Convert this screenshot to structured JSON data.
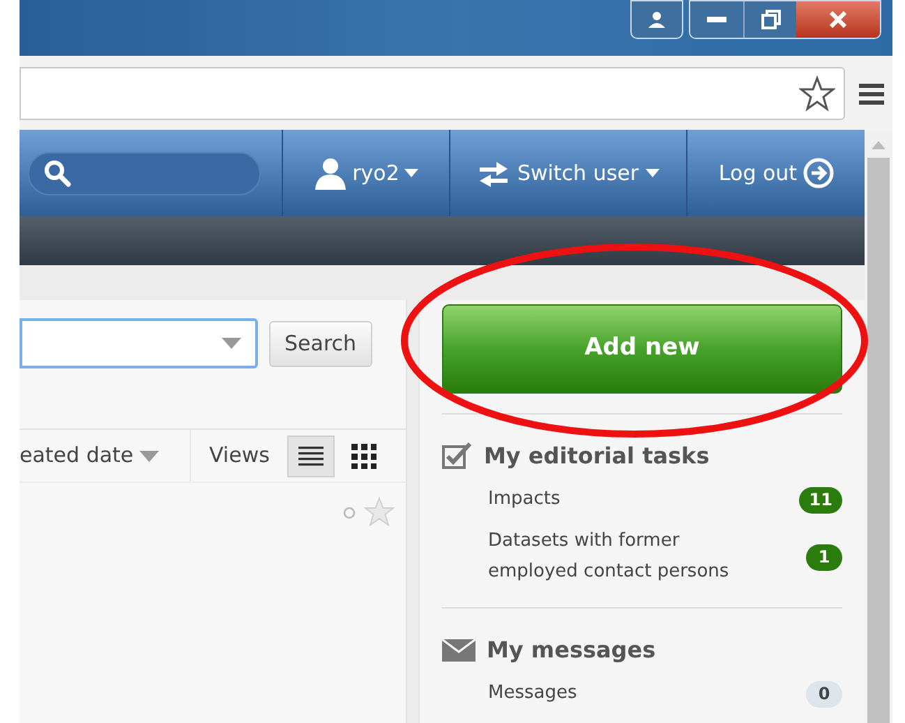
{
  "nav": {
    "user": "ryo2",
    "switch_user": "Switch user",
    "logout": "Log out"
  },
  "search_panel": {
    "search_button": "Search",
    "sort_label": "eated date",
    "views_label": "Views",
    "view_modes": [
      {
        "kind": "list",
        "selected": true
      },
      {
        "kind": "grid",
        "selected": false
      }
    ]
  },
  "sidebar": {
    "add_button": "Add new",
    "sections": [
      {
        "kind": "tasks",
        "title": "My editorial tasks",
        "items": [
          {
            "label": "Impacts",
            "count": "11",
            "color": "#2a7d0c"
          },
          {
            "label": "Datasets with former employed contact persons",
            "count": "1",
            "color": "#2a7d0c"
          }
        ]
      },
      {
        "kind": "messages",
        "title": "My messages",
        "items": [
          {
            "label": "Messages",
            "count": "0",
            "color": "#dde4ec"
          }
        ]
      }
    ]
  }
}
